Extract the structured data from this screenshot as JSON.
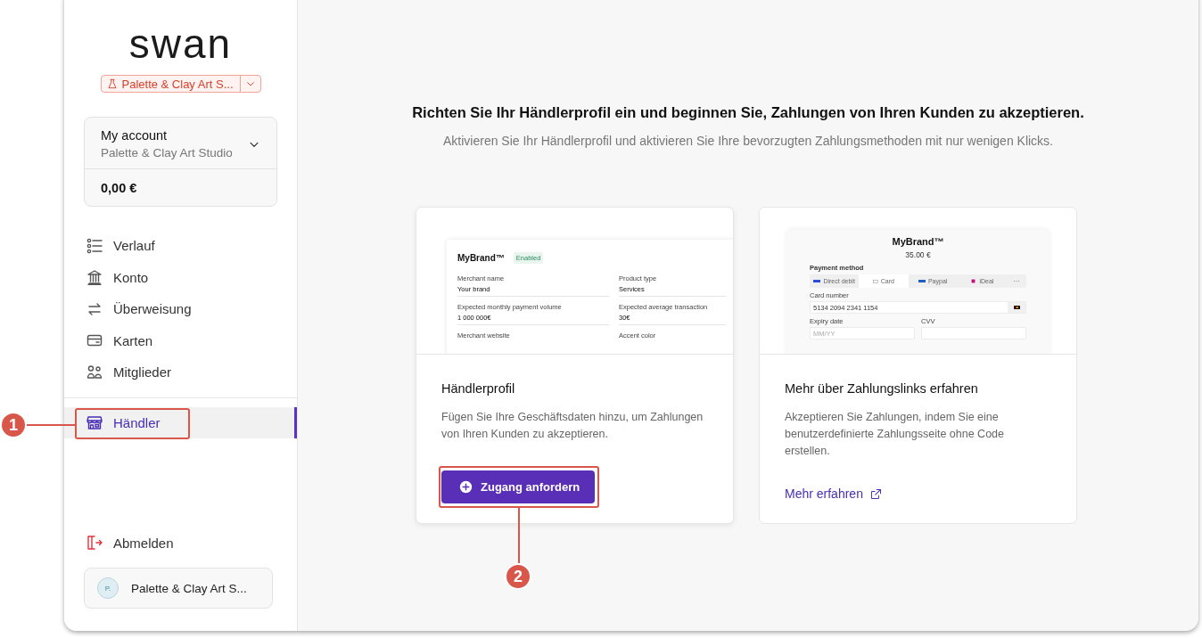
{
  "sidebar": {
    "logo": "swan",
    "project_switcher": {
      "label": "Palette & Clay Art S..."
    },
    "account": {
      "title": "My account",
      "subtitle": "Palette & Clay Art Studio",
      "balance": "0,00 €"
    },
    "nav_items": [
      {
        "label": "Verlauf",
        "selected": false
      },
      {
        "label": "Konto",
        "selected": false
      },
      {
        "label": "Überweisung",
        "selected": false
      },
      {
        "label": "Karten",
        "selected": false
      },
      {
        "label": "Mitglieder",
        "selected": false
      }
    ],
    "merchant_item": {
      "label": "Händler",
      "selected": true
    },
    "logout": "Abmelden",
    "profile": {
      "avatar": "P.",
      "name": "Palette & Clay Art S..."
    }
  },
  "main": {
    "title": "Richten Sie Ihr Händlerprofil ein und beginnen Sie, Zahlungen von Ihren Kunden zu akzeptieren.",
    "subtitle": "Aktivieren Sie Ihr Händlerprofil und aktivieren Sie Ihre bevorzugten Zahlungsmethoden mit nur wenigen Klicks.",
    "cards": [
      {
        "kind": "profile",
        "title": "Händlerprofil",
        "description": "Fügen Sie Ihre Geschäftsdaten hinzu, um Zahlungen von Ihren Kunden zu akzeptieren.",
        "action": "Zugang anfordern",
        "preview": {
          "brand": "MyBrand™",
          "badge": "Enabled",
          "fields": [
            {
              "label": "Merchant name",
              "value": "Your brand"
            },
            {
              "label": "Product type",
              "value": "Services"
            },
            {
              "label": "Expected monthly payment volume",
              "value": "1 000 000€"
            },
            {
              "label": "Expected average transaction",
              "value": "30€"
            },
            {
              "label": "Merchant website"
            },
            {
              "label": "Accent color"
            }
          ]
        }
      },
      {
        "kind": "link",
        "title": "Mehr über Zahlungslinks erfahren",
        "description": "Akzeptieren Sie Zahlungen, indem Sie eine benutzerdefinierte Zahlungsseite ohne Code erstellen.",
        "action": "Mehr erfahren",
        "preview": {
          "brand": "MyBrand™",
          "amount": "35.00 €",
          "method_label": "Payment method",
          "methods": [
            {
              "label": "Direct debit",
              "selected": false
            },
            {
              "label": "Card",
              "selected": true
            },
            {
              "label": "Paypal",
              "selected": false
            },
            {
              "label": "iDeal",
              "selected": false
            },
            {
              "label": "···",
              "selected": false
            }
          ],
          "card_number_label": "Card number",
          "card_number": "5134 2094 2341 1154",
          "expiry_label": "Expiry date",
          "expiry_placeholder": "MM/YY",
          "cvv_label": "CVV"
        }
      }
    ]
  },
  "annotations": [
    {
      "number": "1"
    },
    {
      "number": "2"
    }
  ]
}
